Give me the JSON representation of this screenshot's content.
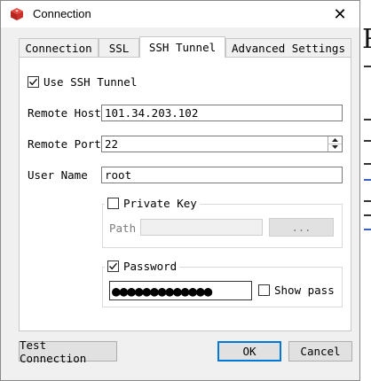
{
  "window": {
    "title": "Connection",
    "close_glyph": "✕",
    "icon": "app-logo-icon"
  },
  "tabs": [
    {
      "label": "Connection",
      "active": false
    },
    {
      "label": "SSL",
      "active": false
    },
    {
      "label": "SSH Tunnel",
      "active": true
    },
    {
      "label": "Advanced Settings",
      "active": false
    }
  ],
  "ssh": {
    "use_tunnel_label": "Use SSH Tunnel",
    "use_tunnel_checked": true,
    "remote_host_label": "Remote Host",
    "remote_host_value": "101.34.203.102",
    "remote_port_label": "Remote Port",
    "remote_port_value": "22",
    "user_name_label": "User Name",
    "user_name_value": "root",
    "private_key": {
      "label": "Private Key",
      "checked": false,
      "path_label": "Path",
      "path_value": "",
      "browse_label": "..."
    },
    "password": {
      "label": "Password",
      "checked": true,
      "masked_value": "●●●●●●●●●●●●●",
      "show_pass_label": "Show pass",
      "show_pass_checked": false
    }
  },
  "buttons": {
    "test_connection": "Test Connection",
    "ok": "OK",
    "cancel": "Cancel"
  },
  "colors": {
    "app_icon": "#d4322a",
    "primary_border": "#0078d7"
  }
}
